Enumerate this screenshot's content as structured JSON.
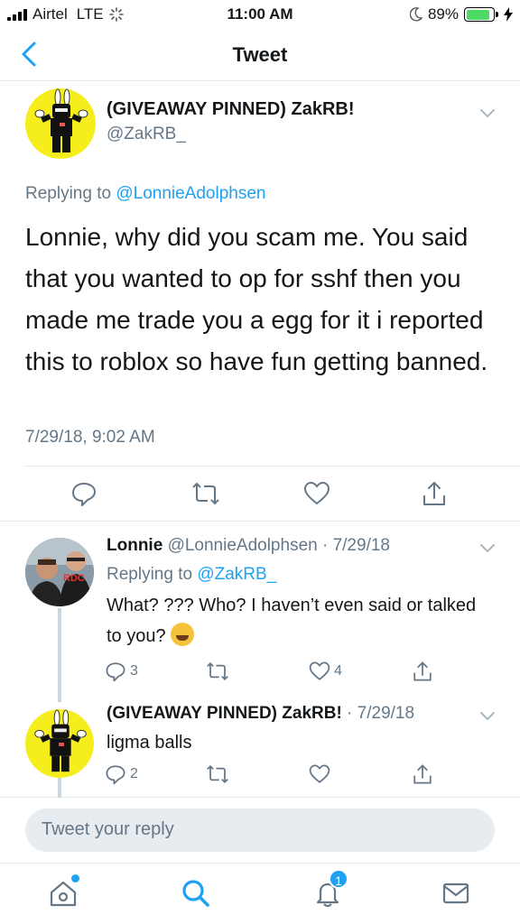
{
  "status_bar": {
    "carrier": "Airtel",
    "network": "LTE",
    "time": "11:00 AM",
    "battery": "89%",
    "battery_level": 0.89
  },
  "nav": {
    "title": "Tweet"
  },
  "tweet": {
    "name": "(GIVEAWAY PINNED) ZakRB!",
    "handle": "@ZakRB_",
    "replying_label": "Replying to",
    "replying_to": "@LonnieAdolphsen",
    "text": "Lonnie, why did you scam me. You said that you wanted to op for sshf then you made me trade you a egg for it i reported this to roblox so have fun getting banned.",
    "date": "7/29/18, 9:02 AM"
  },
  "replies": [
    {
      "name": "Lonnie",
      "handle": "@LonnieAdolphsen",
      "meta": " · 7/29/18",
      "replying_label": "Replying to",
      "replying_to": "@ZakRB_",
      "text": "What? ??? Who? I haven’t even said or talked to you?",
      "reply_count": "3",
      "like_count": "4"
    },
    {
      "name": "(GIVEAWAY PINNED) ZakRB!",
      "meta": " · 7/29/18",
      "text": "ligma balls",
      "reply_count": "2"
    }
  ],
  "compose": {
    "placeholder": "Tweet your reply"
  },
  "tabbar": {
    "notifications_badge": "1"
  },
  "colors": {
    "accent": "#1da1f2",
    "muted": "#657786",
    "border": "#e1e8ed",
    "avatar_bg": "#f6ee1c"
  },
  "icons": [
    "back-chevron-icon",
    "reply-icon",
    "retweet-icon",
    "like-icon",
    "share-icon",
    "caret-down-icon",
    "home-icon",
    "search-icon",
    "notifications-icon",
    "messages-icon"
  ]
}
